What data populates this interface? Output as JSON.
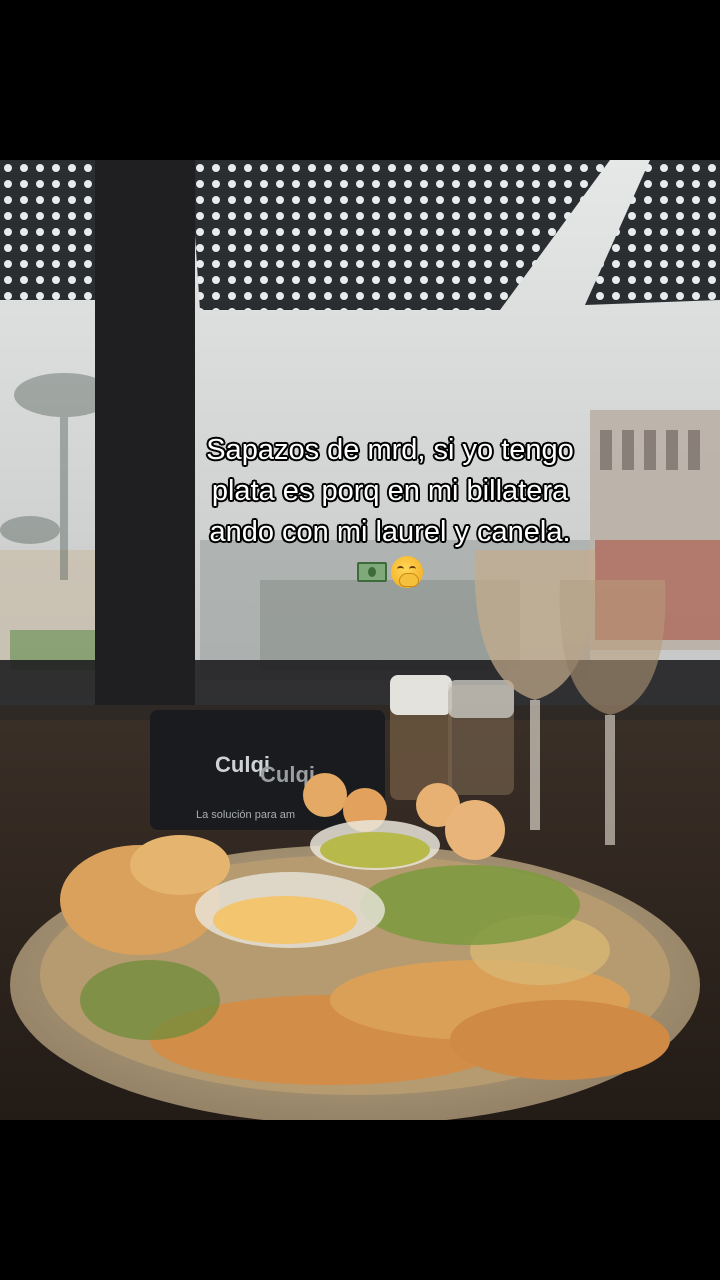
{
  "caption": {
    "line1": "Sapazos de mrd, si yo tengo",
    "line2": "plata es porq en mi billatera",
    "line3": "ando con mi laurel y canela."
  },
  "emojis": [
    "money-with-eyes-icon",
    "face-with-hand-over-mouth-icon"
  ],
  "sign": {
    "brand_top": "Culqi",
    "brand_bottom": "Culqi",
    "tagline": "La solución para am"
  }
}
